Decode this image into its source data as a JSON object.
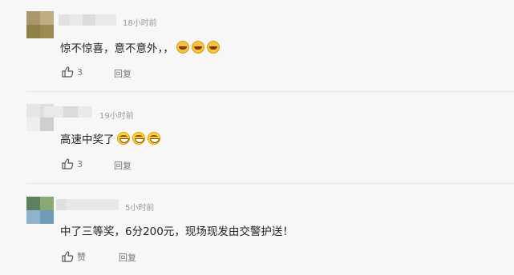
{
  "comments": [
    {
      "time": "18小时前",
      "text": "惊不惊喜，意不意外，，",
      "emoji": [
        "laugh-emoji",
        "laugh-emoji",
        "laugh-emoji"
      ],
      "like": "3",
      "reply": "回复",
      "avatar_colors": [
        "#a9966a",
        "#8e8046",
        "#bfae80",
        "#9c8a52"
      ]
    },
    {
      "time": "19小时前",
      "text": "高速中奖了",
      "emoji": [
        "grin-emoji",
        "grin-emoji",
        "grin-emoji"
      ],
      "like": "3",
      "reply": "回复",
      "avatar_colors": [
        "#e6e6e6",
        "#d8d8d8",
        "#dedede",
        "#cfcfcf"
      ]
    },
    {
      "time": "5小时前",
      "text": "中了三等奖，6分200元，现场现发由交警护送！",
      "emoji": [],
      "like": "赞",
      "reply": "回复",
      "avatar_colors": [
        "#5d8060",
        "#8aa874",
        "#8fb3cc",
        "#6d9bb8"
      ]
    }
  ]
}
